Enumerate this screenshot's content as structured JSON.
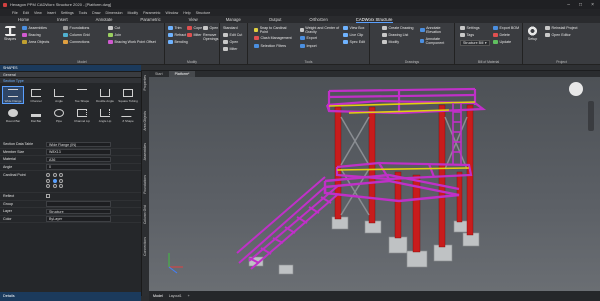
{
  "app": {
    "title": "Hexagon PPM CADWorx Structure 2020 - [Platform.dwg]"
  },
  "menu": [
    "File",
    "Edit",
    "View",
    "Insert",
    "Settings",
    "Tools",
    "Draw",
    "Dimension",
    "Modify",
    "Parametric",
    "Window",
    "Help",
    "Structure"
  ],
  "tabs": [
    "Home",
    "Insert",
    "Annotate",
    "Parametric",
    "View",
    "Manage",
    "Output",
    "OrthoGen",
    "CADWorx Structure"
  ],
  "active_tab": "CADWorx Structure",
  "ribbon": {
    "groups": [
      "Model",
      "Modify",
      "Tools",
      "Drawings",
      "Bill of Material",
      "Project"
    ],
    "model": {
      "shapes": "Shapes",
      "col1": [
        "Assemblies",
        "Bracing",
        "Area Objects"
      ],
      "col2": [
        "Foundations",
        "Column Grid",
        "Connections"
      ],
      "col3": [
        "Cut",
        "Join",
        "Bracing Work Point Offset"
      ]
    },
    "modify": {
      "col1": [
        "Trim",
        "Refract",
        "Bending"
      ],
      "col2": [
        "Cope",
        "Miter"
      ],
      "col3": [
        "Open",
        "Remove Openings"
      ],
      "big": [
        "Standard",
        "Edit Cut",
        "Open",
        "Miter"
      ]
    },
    "tools": {
      "col1": [
        "Snap to Cardinal Point",
        "Clash Management",
        "Selection Filters"
      ],
      "col2": [
        "Weight and Center of Gravity",
        "Export",
        "Import"
      ],
      "col3": [
        "View Box",
        "Live Clip",
        "Spec Edit"
      ]
    },
    "drawings": {
      "col1": [
        "Create Drawing",
        "Drawing List",
        "Modify"
      ],
      "col2": [
        "Annotate Elevation",
        "Annotate Component"
      ]
    },
    "bom": {
      "col1": [
        "Settings",
        "Tags",
        "Structure Bill"
      ],
      "col2": [
        "Export BOM",
        "Delete",
        "Update"
      ]
    },
    "project": {
      "big": "Setup",
      "col1": [
        "Reinstall Project",
        "Open Editor"
      ]
    }
  },
  "panel": {
    "title": "SHAPES",
    "general": "General",
    "section_type": "Section Type",
    "shapes": [
      "Wide Flange",
      "Channel",
      "Angle",
      "Tee Shape",
      "Double Angle",
      "Square Tubing",
      "Round Bar",
      "Flat Bar",
      "Pipe",
      "Channel Lip",
      "Angle Lip",
      "Z Shape"
    ],
    "selected_shape": "Wide Flange",
    "props": [
      {
        "k": "Section Data Table",
        "v": "Wide Flange (IN)"
      },
      {
        "k": "Member Size",
        "v": "W8X13"
      },
      {
        "k": "Material",
        "v": "A36"
      },
      {
        "k": "Angle",
        "v": "0"
      },
      {
        "k": "Cardinal Point",
        "v": ""
      },
      {
        "k": "Reflect",
        "v": ""
      },
      {
        "k": "Group",
        "v": ""
      },
      {
        "k": "Layer",
        "v": "Structure"
      },
      {
        "k": "Color",
        "v": "ByLayer"
      }
    ],
    "bottom": "Details",
    "vtabs": [
      "Properties",
      "Area Objects",
      "Assemblies",
      "Foundations",
      "Column Grid",
      "Connections"
    ]
  },
  "doc_tabs": [
    "Start",
    "Platform*"
  ],
  "status": [
    "Model",
    "Layout1",
    "+"
  ],
  "colors": {
    "member": "#c030c8",
    "column": "#c81c1c",
    "rail": "#e0d010",
    "concrete": "#bfc2c4",
    "steel_gray": "#8a8d92"
  }
}
